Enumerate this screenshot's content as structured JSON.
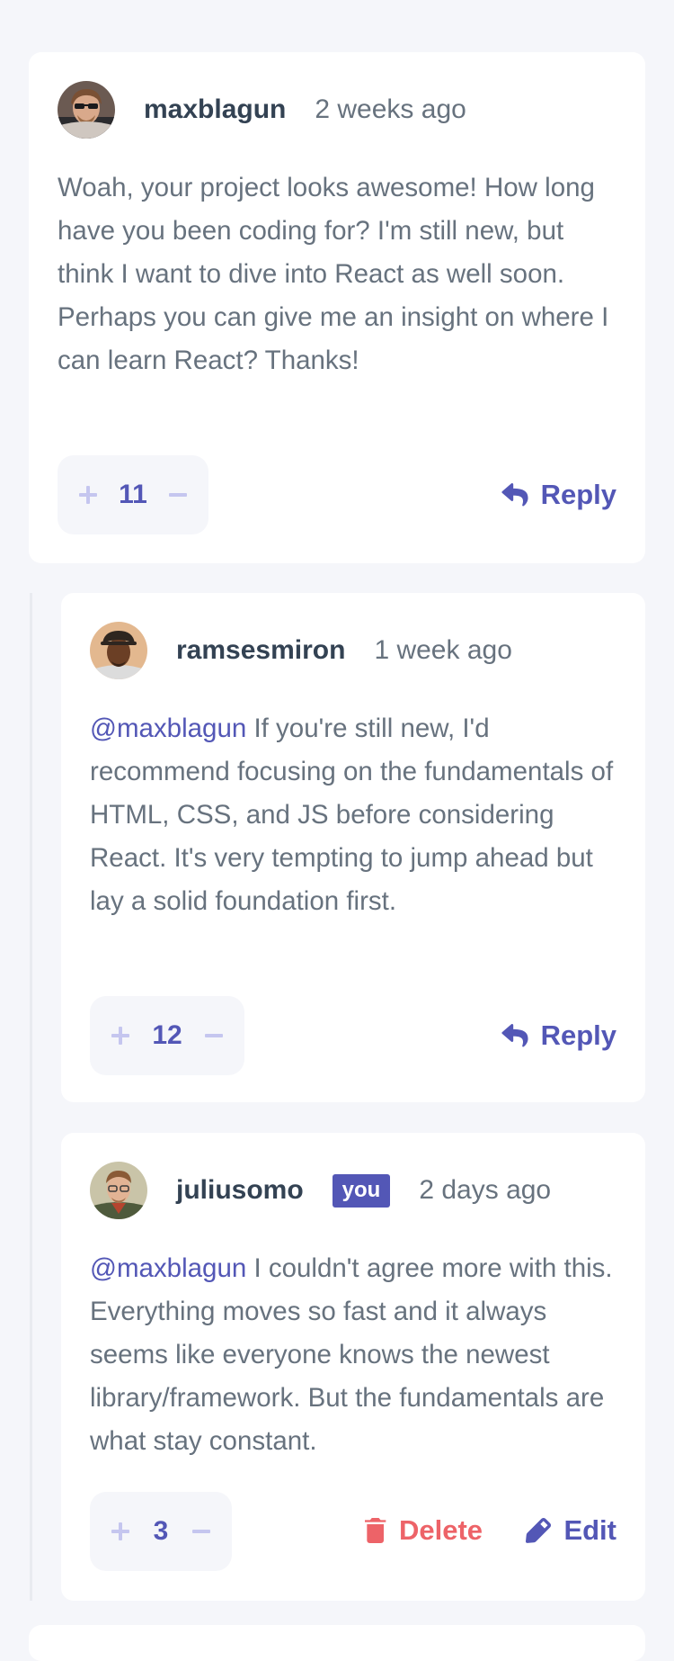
{
  "colors": {
    "page_bg": "#f5f6fa",
    "card_bg": "#ffffff",
    "accent": "#5357b6",
    "accent_light": "#c5c6ef",
    "danger": "#ed6368",
    "username": "#334253",
    "text": "#67727e"
  },
  "comments": [
    {
      "avatar_icon": "avatar-maxblagun",
      "username": "maxblagun",
      "time": "2 weeks ago",
      "mention": "",
      "text": "Woah, your project looks awesome! How long have you been coding for? I'm still new, but think I want to dive into React as well soon. Perhaps you can give me an insight on where I can learn React? Thanks!",
      "score": "11",
      "reply_label": "Reply"
    },
    {
      "avatar_icon": "avatar-ramsesmiron",
      "username": "ramsesmiron",
      "time": "1 week ago",
      "mention": "@maxblagun",
      "text": "If you're still new, I'd recommend focusing on the fundamentals of HTML, CSS, and JS before considering React. It's very tempting to jump ahead but lay a solid foundation first.",
      "score": "12",
      "reply_label": "Reply"
    },
    {
      "avatar_icon": "avatar-juliusomo",
      "username": "juliusomo",
      "badge": "you",
      "time": "2 days ago",
      "mention": "@maxblagun",
      "text": "I couldn't agree more with this. Everything moves so fast and it always seems like everyone knows the newest library/framework. But the fundamentals are what stay constant.",
      "score": "3",
      "delete_label": "Delete",
      "edit_label": "Edit"
    }
  ]
}
